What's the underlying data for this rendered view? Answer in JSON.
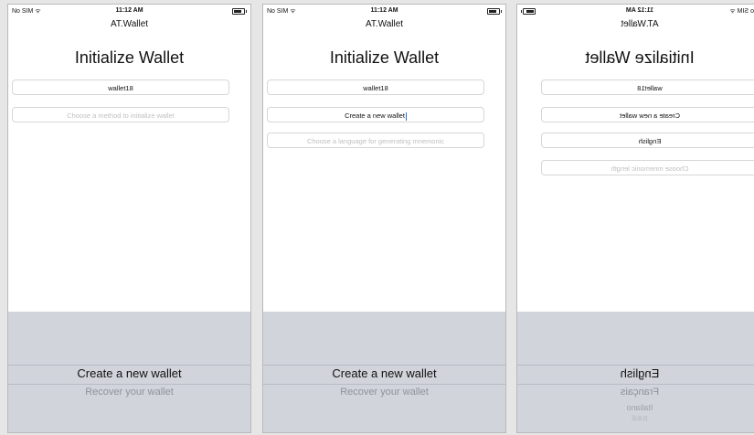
{
  "status_bar": {
    "carrier": "No SIM ᯤ",
    "time": "11:12 AM"
  },
  "app_title": "AT.Wallet",
  "page_title": "Initialize Wallet",
  "screens": [
    {
      "wallet_name": "wallet18",
      "method_placeholder": "Choose a method to initialize wallet",
      "picker_options": [
        "Create a new wallet",
        "Recover your wallet"
      ]
    },
    {
      "wallet_name": "wallet18",
      "method_value": "Create a new wallet",
      "language_placeholder": "Choose a language for generating mnemonic",
      "picker_options": [
        "Create a new wallet",
        "Recover your wallet"
      ]
    },
    {
      "wallet_name": "wallet18",
      "method_value": "Create a new wallet",
      "language_value": "English",
      "mnemonic_placeholder": "Choose mnemonic length",
      "picker_options": [
        "English",
        "Français",
        "Italiano",
        "日本語"
      ]
    }
  ]
}
